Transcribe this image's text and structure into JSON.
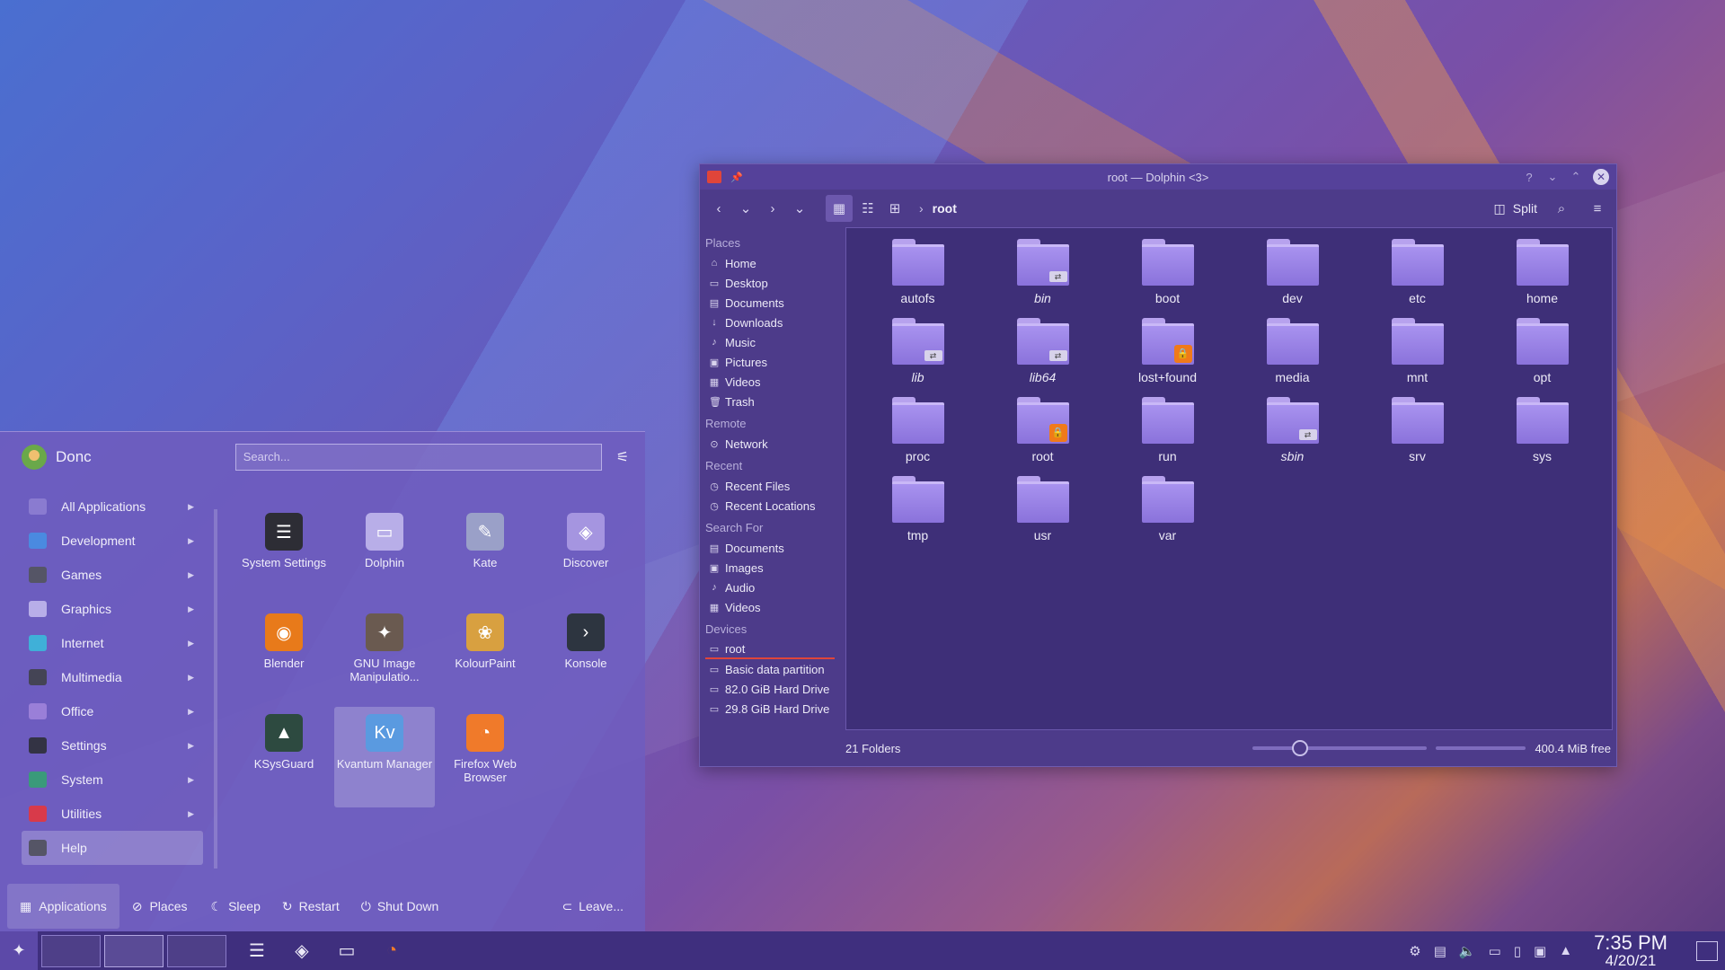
{
  "dolphin": {
    "title": "root — Dolphin <3>",
    "breadcrumb": "root",
    "split_label": "Split",
    "places_groups": [
      {
        "label": "Places",
        "items": [
          {
            "label": "Home",
            "icon": "home-icon"
          },
          {
            "label": "Desktop",
            "icon": "desktop-icon"
          },
          {
            "label": "Documents",
            "icon": "documents-icon"
          },
          {
            "label": "Downloads",
            "icon": "downloads-icon"
          },
          {
            "label": "Music",
            "icon": "music-icon"
          },
          {
            "label": "Pictures",
            "icon": "pictures-icon"
          },
          {
            "label": "Videos",
            "icon": "videos-icon"
          },
          {
            "label": "Trash",
            "icon": "trash-icon"
          }
        ]
      },
      {
        "label": "Remote",
        "items": [
          {
            "label": "Network",
            "icon": "network-icon"
          }
        ]
      },
      {
        "label": "Recent",
        "items": [
          {
            "label": "Recent Files",
            "icon": "recent-files-icon"
          },
          {
            "label": "Recent Locations",
            "icon": "recent-locations-icon"
          }
        ]
      },
      {
        "label": "Search For",
        "items": [
          {
            "label": "Documents",
            "icon": "documents-icon"
          },
          {
            "label": "Images",
            "icon": "images-icon"
          },
          {
            "label": "Audio",
            "icon": "audio-icon"
          },
          {
            "label": "Videos",
            "icon": "videos-icon"
          }
        ]
      },
      {
        "label": "Devices",
        "items": [
          {
            "label": "root",
            "icon": "drive-icon",
            "current": true
          },
          {
            "label": "Basic data partition",
            "icon": "drive-icon"
          },
          {
            "label": "82.0 GiB Hard Drive",
            "icon": "drive-icon"
          },
          {
            "label": "29.8 GiB Hard Drive",
            "icon": "drive-icon"
          }
        ]
      }
    ],
    "folders": [
      {
        "name": "autofs",
        "italic": false,
        "badge": ""
      },
      {
        "name": "bin",
        "italic": true,
        "badge": "link"
      },
      {
        "name": "boot",
        "italic": false,
        "badge": ""
      },
      {
        "name": "dev",
        "italic": false,
        "badge": ""
      },
      {
        "name": "etc",
        "italic": false,
        "badge": ""
      },
      {
        "name": "home",
        "italic": false,
        "badge": ""
      },
      {
        "name": "lib",
        "italic": true,
        "badge": "link"
      },
      {
        "name": "lib64",
        "italic": true,
        "badge": "link"
      },
      {
        "name": "lost+found",
        "italic": false,
        "badge": "lock"
      },
      {
        "name": "media",
        "italic": false,
        "badge": ""
      },
      {
        "name": "mnt",
        "italic": false,
        "badge": ""
      },
      {
        "name": "opt",
        "italic": false,
        "badge": ""
      },
      {
        "name": "proc",
        "italic": false,
        "badge": ""
      },
      {
        "name": "root",
        "italic": false,
        "badge": "lock"
      },
      {
        "name": "run",
        "italic": false,
        "badge": ""
      },
      {
        "name": "sbin",
        "italic": true,
        "badge": "link"
      },
      {
        "name": "srv",
        "italic": false,
        "badge": ""
      },
      {
        "name": "sys",
        "italic": false,
        "badge": ""
      },
      {
        "name": "tmp",
        "italic": false,
        "badge": ""
      },
      {
        "name": "usr",
        "italic": false,
        "badge": ""
      },
      {
        "name": "var",
        "italic": false,
        "badge": ""
      }
    ],
    "status": {
      "count": "21 Folders",
      "free": "400.4 MiB free",
      "zoom_level": 0.25
    }
  },
  "kickoff": {
    "user_name": "Donc",
    "search_placeholder": "Search...",
    "categories": [
      {
        "label": "All Applications",
        "color": "#8a7bd0"
      },
      {
        "label": "Development",
        "color": "#4a8ae0"
      },
      {
        "label": "Games",
        "color": "#555566"
      },
      {
        "label": "Graphics",
        "color": "#b8aee8"
      },
      {
        "label": "Internet",
        "color": "#3fb0d8"
      },
      {
        "label": "Multimedia",
        "color": "#444455"
      },
      {
        "label": "Office",
        "color": "#9a7fd8"
      },
      {
        "label": "Settings",
        "color": "#333344"
      },
      {
        "label": "System",
        "color": "#3a9a7a"
      },
      {
        "label": "Utilities",
        "color": "#d83a4a"
      },
      {
        "label": "Help",
        "color": "#555566",
        "selected": true
      }
    ],
    "apps": [
      {
        "label": "System Settings",
        "color": "#2d2d35",
        "glyph": "☰"
      },
      {
        "label": "Dolphin",
        "color": "#b8aee8",
        "glyph": "▭"
      },
      {
        "label": "Kate",
        "color": "#9aa0c8",
        "glyph": "✎"
      },
      {
        "label": "Discover",
        "color": "#a595e0",
        "glyph": "◈"
      },
      {
        "label": "Blender",
        "color": "#e87a1a",
        "glyph": "◉"
      },
      {
        "label": "GNU Image Manipulatio...",
        "color": "#6a5a50",
        "glyph": "✦"
      },
      {
        "label": "KolourPaint",
        "color": "#d8a040",
        "glyph": "❀"
      },
      {
        "label": "Konsole",
        "color": "#2d3540",
        "glyph": "›"
      },
      {
        "label": "KSysGuard",
        "color": "#2d4a40",
        "glyph": "▲"
      },
      {
        "label": "Kvantum Manager",
        "color": "#5a9ae0",
        "glyph": "Kv",
        "selected": true
      },
      {
        "label": "Firefox Web Browser",
        "color": "#f07a2a",
        "glyph": "◔"
      }
    ],
    "footer": {
      "tab_applications": "Applications",
      "tab_places": "Places",
      "sleep": "Sleep",
      "restart": "Restart",
      "shutdown": "Shut Down",
      "leave": "Leave..."
    }
  },
  "taskbar": {
    "time": "7:35 PM",
    "date": "4/20/21"
  }
}
